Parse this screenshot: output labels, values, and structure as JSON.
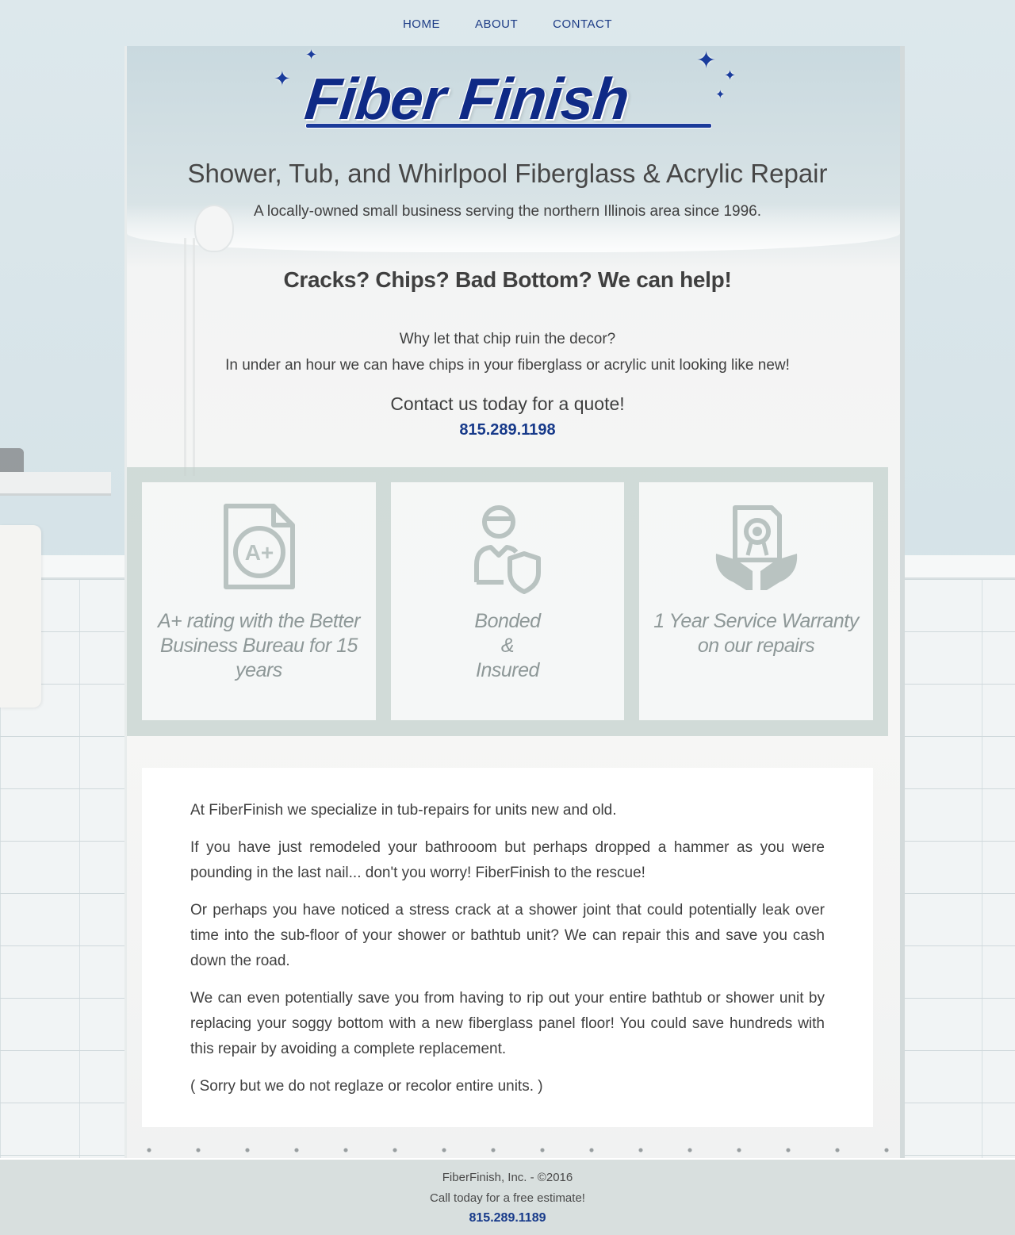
{
  "nav": {
    "items": [
      "HOME",
      "ABOUT",
      "CONTACT"
    ]
  },
  "logo": {
    "text": "Fiber Finish"
  },
  "hero": {
    "tagline": "Shower, Tub, and Whirlpool Fiberglass & Acrylic Repair",
    "subtagline": "A locally-owned small business serving the northern Illinois area since 1996.",
    "headline": "Cracks?  Chips?  Bad Bottom?  We can help!",
    "intro_line1": "Why let that chip ruin the decor?",
    "intro_line2": "In under an hour we can have chips in your fiberglass or acrylic unit looking like new!",
    "cta": "Contact us today for a quote!",
    "phone": "815.289.1198"
  },
  "features": [
    {
      "icon": "a-plus-document-icon",
      "text": "A+ rating with the Better Business Bureau for 15 years"
    },
    {
      "icon": "bonded-worker-shield-icon",
      "text_lines": [
        "Bonded",
        "&",
        "Insured"
      ]
    },
    {
      "icon": "warranty-certificate-hands-icon",
      "text": "1 Year Service Warranty on our repairs"
    }
  ],
  "about": {
    "paragraphs": [
      "At FiberFinish we specialize in tub-repairs for units new and old.",
      "If you have just remodeled your bathrooom but perhaps dropped a hammer as you were pounding in the last nail... don't you worry! FiberFinish to the rescue!",
      "Or perhaps you have noticed a stress crack at a shower joint that could potentially leak over time into the sub-floor of your shower or bathtub unit? We can repair this and save you cash down the road.",
      "We can even potentially save you from having to rip out your entire bathtub or shower unit by replacing your soggy bottom with a new fiberglass panel floor! You could save hundreds with this repair by avoiding a complete replacement.",
      "( Sorry but we do not reglaze or recolor entire units. )"
    ]
  },
  "footer": {
    "copyright": "FiberFinish, Inc. - ©2016",
    "call": "Call today for a free estimate!",
    "phone": "815.289.1189"
  },
  "colors": {
    "brand_blue": "#0f2a86",
    "link_blue": "#173a8a",
    "feature_text": "#8e9898",
    "footer_bg": "#d8dfde"
  }
}
